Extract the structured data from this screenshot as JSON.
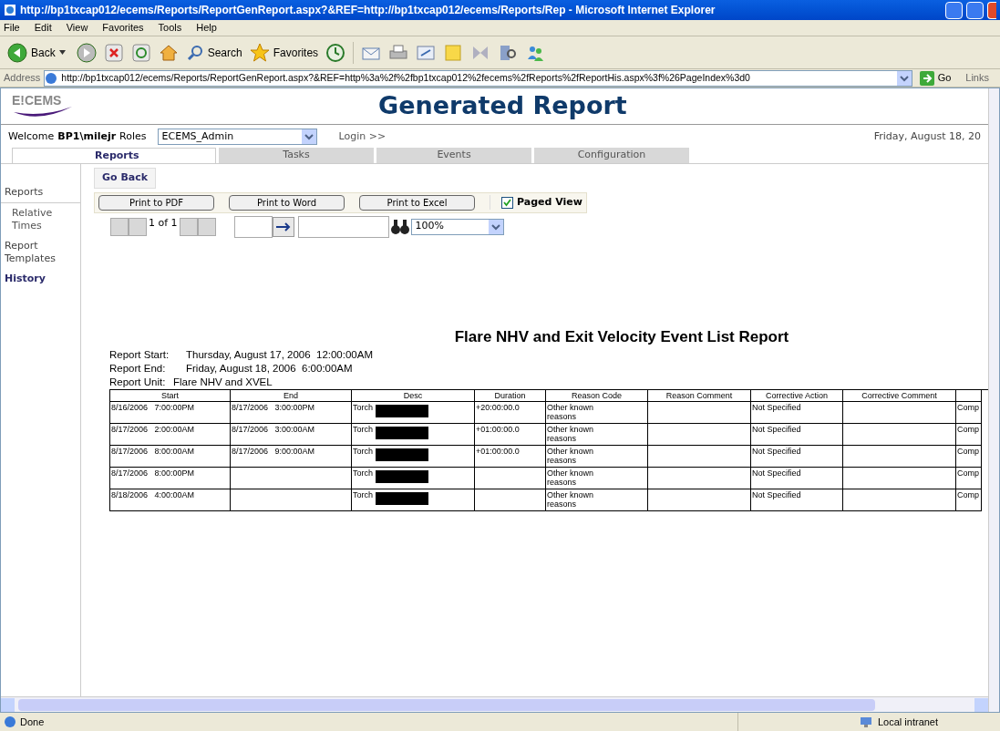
{
  "window": {
    "title": "http://bp1txcap012/ecems/Reports/ReportGenReport.aspx?&REF=http://bp1txcap012/ecems/Reports/Rep - Microsoft Internet Explorer"
  },
  "menu": [
    "File",
    "Edit",
    "View",
    "Favorites",
    "Tools",
    "Help"
  ],
  "toolbar": {
    "back": "Back",
    "search": "Search",
    "favorites": "Favorites"
  },
  "address": {
    "label": "Address",
    "value": "http://bp1txcap012/ecems/Reports/ReportGenReport.aspx?&REF=http%3a%2f%2fbp1txcap012%2fecems%2fReports%2fReportHis.aspx%3f%26PageIndex%3d0",
    "go": "Go",
    "links": "Links"
  },
  "header": {
    "logo": "E!CEMS",
    "title": "Generated Report"
  },
  "user_bar": {
    "welcome": "Welcome",
    "user": "BP1\\milejr",
    "roles_label": "Roles",
    "role": "ECEMS_Admin",
    "login": "Login >>",
    "date": "Friday, August 18, 20"
  },
  "tabs": [
    {
      "label": "Reports",
      "selected": true
    },
    {
      "label": "Tasks",
      "selected": false
    },
    {
      "label": "Events",
      "selected": false
    },
    {
      "label": "Configuration",
      "selected": false
    }
  ],
  "sidebar": {
    "items": [
      {
        "label": "Reports",
        "selected": false,
        "children": [
          {
            "label": "Relative Times",
            "selected": false
          }
        ]
      },
      {
        "label": "Report Templates",
        "selected": false
      },
      {
        "label": "History",
        "selected": true
      }
    ]
  },
  "go_back": "Go Back",
  "print_buttons": [
    "Print to PDF",
    "Print to Word",
    "Print to Excel"
  ],
  "paged_view": {
    "label": "Paged View",
    "checked": true
  },
  "pager": {
    "text": "1 of 1",
    "zoom": "100%"
  },
  "report": {
    "title": "Flare NHV and Exit Velocity Event List Report",
    "info": [
      {
        "label": "Report Start:",
        "value": "Thursday, August 17, 2006  12:00:00AM"
      },
      {
        "label": "Report End:",
        "value": "Friday, August 18, 2006  6:00:00AM"
      },
      {
        "label": "Report Unit:",
        "value": "Flare NHV and XVEL"
      }
    ],
    "columns": [
      "Start",
      "End",
      "Desc",
      "Duration",
      "Reason Code",
      "Reason Comment",
      "Corrective Action",
      "Corrective Comment"
    ],
    "rows": [
      {
        "start": "8/16/2006   7:00:00PM",
        "end": "8/17/2006   3:00:00PM",
        "desc": "Torch",
        "duration": "+20:00:00.0",
        "reason": "Other known reasons",
        "action": "Not Specified",
        "column_9": "Comp"
      },
      {
        "start": "8/17/2006   2:00:00AM",
        "end": "8/17/2006   3:00:00AM",
        "desc": "Torch",
        "duration": "+01:00:00.0",
        "reason": "Other known reasons",
        "action": "Not Specified",
        "column_9": "Comp"
      },
      {
        "start": "8/17/2006   8:00:00AM",
        "end": "8/17/2006   9:00:00AM",
        "desc": "Torch",
        "duration": "+01:00:00.0",
        "reason": "Other known reasons",
        "action": "Not Specified",
        "column_9": "Comp"
      },
      {
        "start": "8/17/2006   8:00:00PM",
        "desc": "Torch",
        "reason": "Other known reasons",
        "action": "Not Specified",
        "column_9": "Comp"
      },
      {
        "start": "8/18/2006   4:00:00AM",
        "desc": "Torch",
        "reason": "Other known reasons",
        "action": "Not Specified",
        "column_9": "Comp"
      }
    ]
  },
  "status_bar": {
    "text": "Done",
    "zone": "Local intranet"
  }
}
